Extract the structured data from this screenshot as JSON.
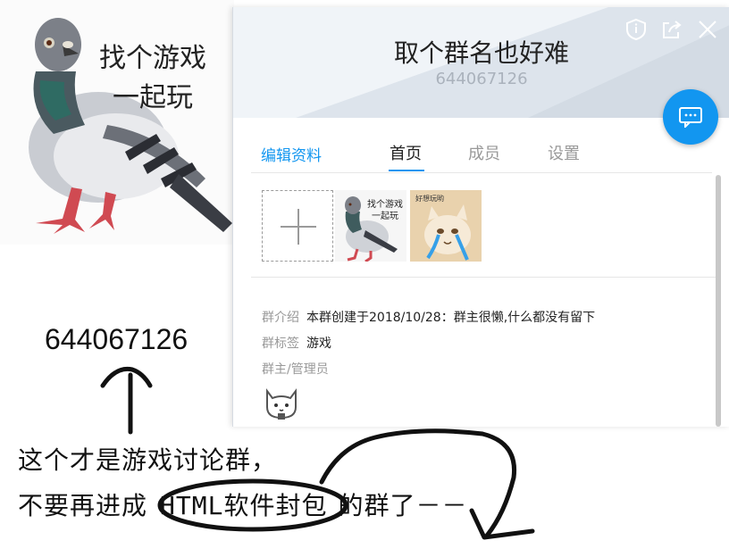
{
  "meme": {
    "caption_line1": "找个游戏",
    "caption_line2": "一起玩"
  },
  "annotation": {
    "number": "644067126",
    "line1": "这个才是游戏讨论群，",
    "line2_before": "不要再进成",
    "line2_circled": "HTML软件封包",
    "line2_after": "的群了－－"
  },
  "panel": {
    "title": "取个群名也好难",
    "group_id": "644067126",
    "edit_label": "编辑资料",
    "tabs": [
      {
        "label": "首页",
        "active": true
      },
      {
        "label": "成员",
        "active": false
      },
      {
        "label": "设置",
        "active": false
      }
    ],
    "album": {
      "thumb1_caption_line1": "找个游戏",
      "thumb1_caption_line2": "一起玩",
      "thumb2_caption": "好想玩哟"
    },
    "intro_label": "群介绍",
    "intro_value": "本群创建于2018/10/28：群主很懒,什么都没有留下",
    "tag_label": "群标签",
    "tag_value": "游戏",
    "admin_label": "群主/管理员"
  },
  "icons": {
    "header": [
      "shield-icon",
      "share-icon",
      "close-icon"
    ],
    "chat": "chat-bubble-icon",
    "add": "plus-icon",
    "admin": "cat-avatar-icon"
  },
  "colors": {
    "accent": "#1296f0",
    "header_bg": "#f0f4f8",
    "muted": "#999999"
  }
}
